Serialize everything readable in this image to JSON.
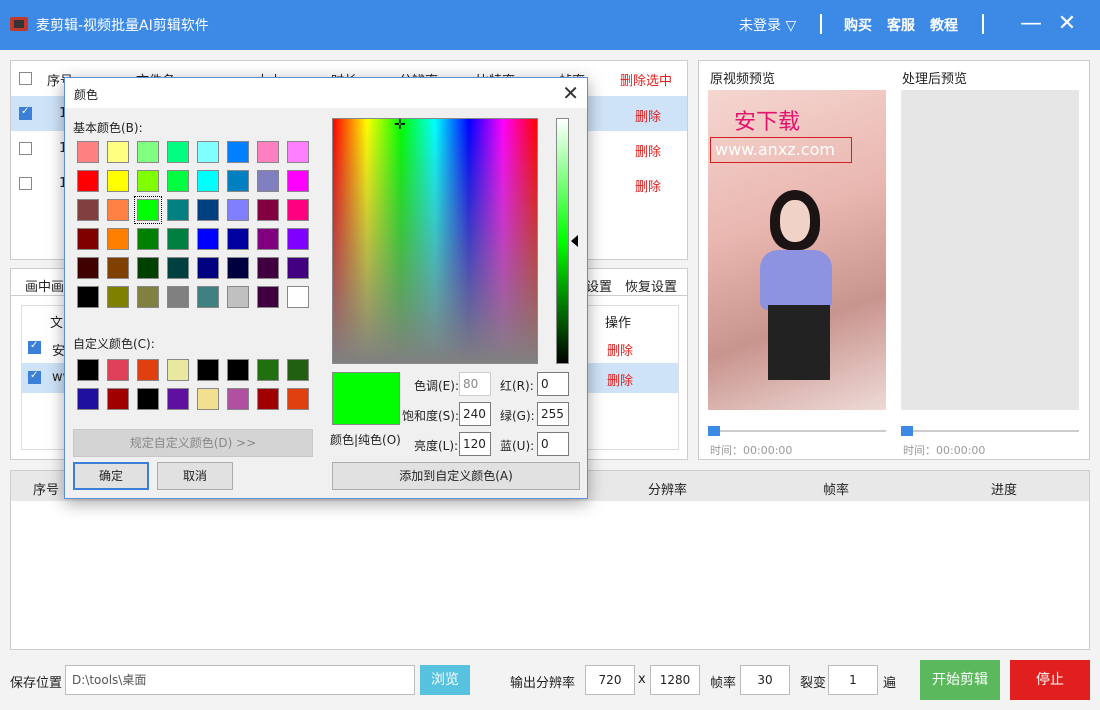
{
  "app": {
    "title": "麦剪辑-视频批量AI剪辑软件",
    "login": "未登录",
    "buy": "购买",
    "service": "客服",
    "tutorial": "教程",
    "minimize": "—",
    "close": "✕"
  },
  "file_list": {
    "headers": [
      "序号",
      "文件名",
      "大小",
      "时长",
      "分辨率",
      "比特率",
      "帧率"
    ],
    "delete_selected": "删除选中",
    "rows": [
      {
        "index": "1",
        "checked": true,
        "action": "删除"
      },
      {
        "index": "1",
        "checked": false,
        "action": "删除"
      },
      {
        "index": "1",
        "checked": false,
        "action": "删除"
      }
    ]
  },
  "tabs": {
    "first": "画中画",
    "settings": "设置",
    "restore": "恢复设置"
  },
  "pip_list": {
    "headers": [
      "文",
      "操作"
    ],
    "rows": [
      {
        "name": "安",
        "checked": true,
        "action": "删除"
      },
      {
        "name": "ww",
        "checked": true,
        "action": "删除"
      }
    ]
  },
  "preview": {
    "original_title": "原视频预览",
    "processed_title": "处理后预览",
    "watermark_text": "安下载",
    "watermark_url": "www.anxz.com",
    "original_time": "时间：00:00:00",
    "processed_time": "时间：00:00:00"
  },
  "progress_table": {
    "headers": [
      "序号",
      "分辨率",
      "帧率",
      "进度"
    ]
  },
  "bottom": {
    "save_label": "保存位置",
    "save_path": "D:\\tools\\桌面",
    "browse": "浏览",
    "resolution_label": "输出分辨率",
    "width": "720",
    "x_sep": "x",
    "height": "1280",
    "fps_label": "帧率",
    "fps": "30",
    "split_label": "裂变",
    "split": "1",
    "split_unit": "遍",
    "start": "开始剪辑",
    "stop": "停止"
  },
  "color_dialog": {
    "title": "颜色",
    "basic_label": "基本颜色(B):",
    "custom_label": "自定义颜色(C):",
    "define_custom": "规定自定义颜色(D) >>",
    "ok": "确定",
    "cancel": "取消",
    "add_custom": "添加到自定义颜色(A)",
    "color_solid": "颜色|纯色(O)",
    "hue_label": "色调(E):",
    "hue": "80",
    "sat_label": "饱和度(S):",
    "sat": "240",
    "lum_label": "亮度(L):",
    "lum": "120",
    "red_label": "红(R):",
    "red": "0",
    "green_label": "绿(G):",
    "green": "255",
    "blue_label": "蓝(U):",
    "blue": "0",
    "selected_color": "#00ff00",
    "basic_colors": [
      "#ff8080",
      "#ffff80",
      "#80ff80",
      "#00ff80",
      "#80ffff",
      "#0080ff",
      "#ff80c0",
      "#ff80ff",
      "#ff0000",
      "#ffff00",
      "#80ff00",
      "#00ff40",
      "#00ffff",
      "#0080c0",
      "#8080c0",
      "#ff00ff",
      "#804040",
      "#ff8040",
      "#00ff00",
      "#008080",
      "#004080",
      "#8080ff",
      "#800040",
      "#ff0080",
      "#800000",
      "#ff8000",
      "#008000",
      "#008040",
      "#0000ff",
      "#0000a0",
      "#800080",
      "#8000ff",
      "#400000",
      "#804000",
      "#004000",
      "#004040",
      "#000080",
      "#000040",
      "#400040",
      "#400080",
      "#000000",
      "#808000",
      "#808040",
      "#808080",
      "#408080",
      "#c0c0c0",
      "#400040",
      "#ffffff"
    ],
    "custom_colors": [
      "#000000",
      "#e0405a",
      "#e04010",
      "#e8e8a0",
      "#000000",
      "#000000",
      "#207010",
      "#206010",
      "#2010a0",
      "#a00000",
      "#000000",
      "#6010a0",
      "#f0e090",
      "#b050a0",
      "#a00000",
      "#e04010"
    ]
  }
}
